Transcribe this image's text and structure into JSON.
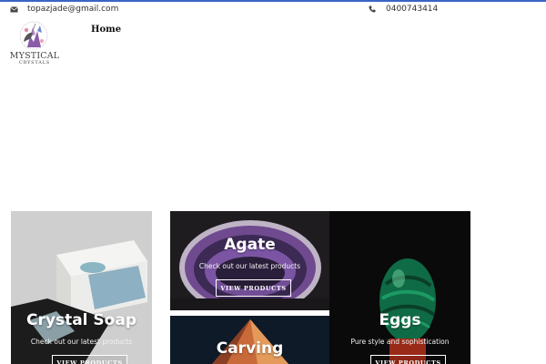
{
  "header": {
    "email": "topazjade@gmail.com",
    "phone": "0400743414"
  },
  "logo": {
    "line1": "MYSTICAL",
    "line2": "CRYSTALS"
  },
  "nav": {
    "home": "Home"
  },
  "categories": [
    {
      "title": "Crystal Soap",
      "subtitle": "Check out our latest products",
      "button": "VIEW PRODUCTS"
    },
    {
      "title": "Agate",
      "subtitle": "Check out our latest products",
      "button": "VIEW PRODUCTS"
    },
    {
      "title": "Carving"
    },
    {
      "title": "Eggs",
      "subtitle": "Pure style and sophistication",
      "button": "VIEW PRODUCTS"
    }
  ],
  "colors": {
    "accent_bar": "#3b64c7"
  }
}
